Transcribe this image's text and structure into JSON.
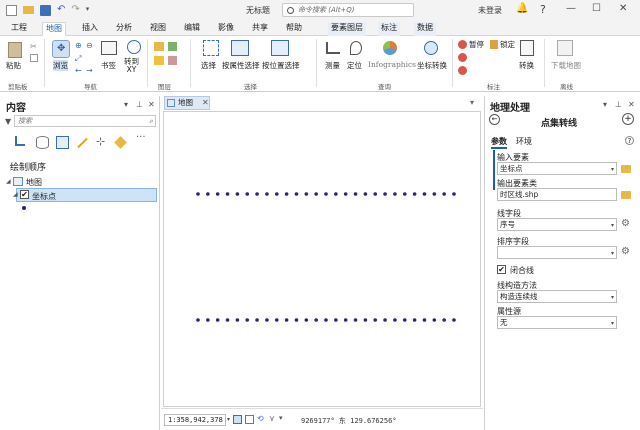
{
  "app_title": "无标题",
  "search": {
    "placeholder": "命令搜索 (Alt+Q)"
  },
  "account": {
    "sign_in": "未登录"
  },
  "tabs": [
    {
      "label": "工程",
      "active": false,
      "contextual": false
    },
    {
      "label": "地图",
      "active": true,
      "contextual": false
    },
    {
      "label": "插入",
      "active": false,
      "contextual": false
    },
    {
      "label": "分析",
      "active": false,
      "contextual": false
    },
    {
      "label": "视图",
      "active": false,
      "contextual": false
    },
    {
      "label": "编辑",
      "active": false,
      "contextual": false
    },
    {
      "label": "影像",
      "active": false,
      "contextual": false
    },
    {
      "label": "共享",
      "active": false,
      "contextual": false
    },
    {
      "label": "帮助",
      "active": false,
      "contextual": false
    },
    {
      "label": "要素图层",
      "active": false,
      "contextual": true
    },
    {
      "label": "标注",
      "active": false,
      "contextual": true
    },
    {
      "label": "数据",
      "active": false,
      "contextual": true
    }
  ],
  "ribbon": {
    "paste": "粘贴",
    "explore": "浏览",
    "bookmarks": "书签",
    "go_to_xy": "转到\nXY",
    "select": "选择",
    "select_by_attr": "按属性选择",
    "select_by_loc": "按位置选择",
    "measure": "测量",
    "locate": "定位",
    "infographics": "Infographics",
    "convert_coords": "坐标转换",
    "pause": "暂停",
    "lock": "锁定",
    "convert": "转换",
    "download_map": "下载地图",
    "groups": {
      "clipboard": "剪贴板",
      "navigate": "导航",
      "layer": "图层",
      "selection": "选择",
      "inquiry": "查询",
      "labeling": "标注",
      "offline": "离线"
    }
  },
  "contents": {
    "title": "内容",
    "search_placeholder": "搜索",
    "drawing_order": "绘制顺序",
    "map_item": "地图",
    "layer_item": "坐标点",
    "layer_checked": true
  },
  "map": {
    "tab_label": "地图",
    "scale": "1:358,942,378",
    "coords": "9269177° 东 129.676256°",
    "point_color": "#2b2670",
    "rows": [
      {
        "count": 27
      },
      {
        "count": 27
      }
    ]
  },
  "gp": {
    "title": "地理处理",
    "tool_title": "点集转线",
    "tab_params": "参数",
    "tab_env": "环境",
    "input_label": "输入要素",
    "input_value": "坐标点",
    "output_label": "输出要素类",
    "output_value": "时区线.shp",
    "line_field_label": "线字段",
    "line_field_value": "序号",
    "sort_field_label": "排序字段",
    "sort_field_value": "",
    "close_line_label": "闭合线",
    "close_line_checked": true,
    "construction_label": "线构造方法",
    "construction_value": "构造连续线",
    "attr_source_label": "属性源",
    "attr_source_value": "无"
  }
}
